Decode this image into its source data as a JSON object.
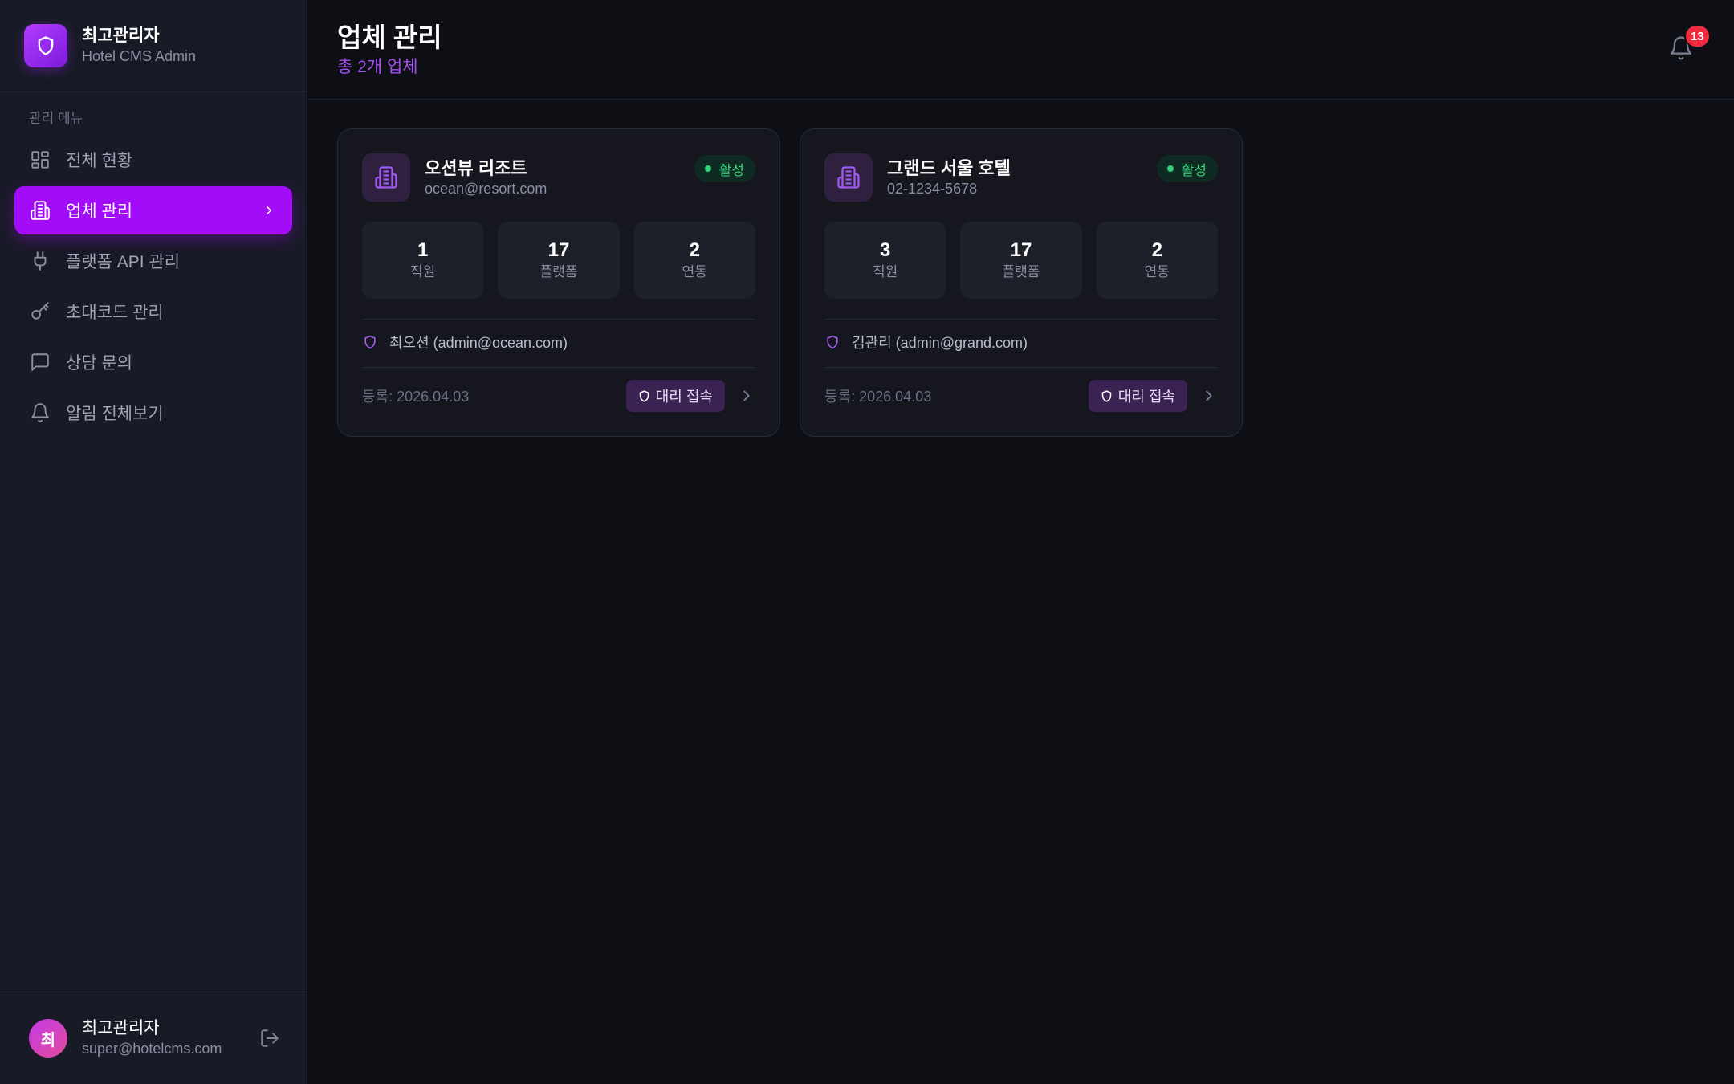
{
  "brand": {
    "title": "최고관리자",
    "subtitle": "Hotel CMS Admin",
    "icon": "shield-icon",
    "accent": "#a30cf8"
  },
  "sidebar": {
    "caption": "관리 메뉴",
    "items": [
      {
        "label": "전체 현황",
        "icon": "dashboard-grid-icon",
        "active": false
      },
      {
        "label": "업체 관리",
        "icon": "building-icon",
        "active": true
      },
      {
        "label": "플랫폼 API 관리",
        "icon": "plug-icon",
        "active": false
      },
      {
        "label": "초대코드 관리",
        "icon": "key-icon",
        "active": false
      },
      {
        "label": "상담 문의",
        "icon": "message-icon",
        "active": false
      },
      {
        "label": "알림 전체보기",
        "icon": "bell-icon",
        "active": false
      }
    ]
  },
  "user": {
    "avatar_initial": "최",
    "name": "최고관리자",
    "email": "super@hotelcms.com"
  },
  "header": {
    "title": "업체 관리",
    "subtitle": "총 2개 업체",
    "notification_count": "13"
  },
  "hotels": [
    {
      "name": "오션뷰 리조트",
      "contact": "ocean@resort.com",
      "status": "활성",
      "stats": [
        {
          "value": "1",
          "label": "직원"
        },
        {
          "value": "17",
          "label": "플랫폼"
        },
        {
          "value": "2",
          "label": "연동"
        }
      ],
      "admin": "최오션 (admin@ocean.com)",
      "registered": "등록: 2026.04.03",
      "proxy_label": "대리 접속"
    },
    {
      "name": "그랜드 서울 호텔",
      "contact": "02-1234-5678",
      "status": "활성",
      "stats": [
        {
          "value": "3",
          "label": "직원"
        },
        {
          "value": "17",
          "label": "플랫폼"
        },
        {
          "value": "2",
          "label": "연동"
        }
      ],
      "admin": "김관리 (admin@grand.com)",
      "registered": "등록: 2026.04.03",
      "proxy_label": "대리 접속"
    }
  ],
  "colors": {
    "background": "#0e0f14",
    "sidebar": "#181a26",
    "card": "#15161e",
    "status_active": "#2fd477",
    "badge": "#ef2b3d"
  }
}
